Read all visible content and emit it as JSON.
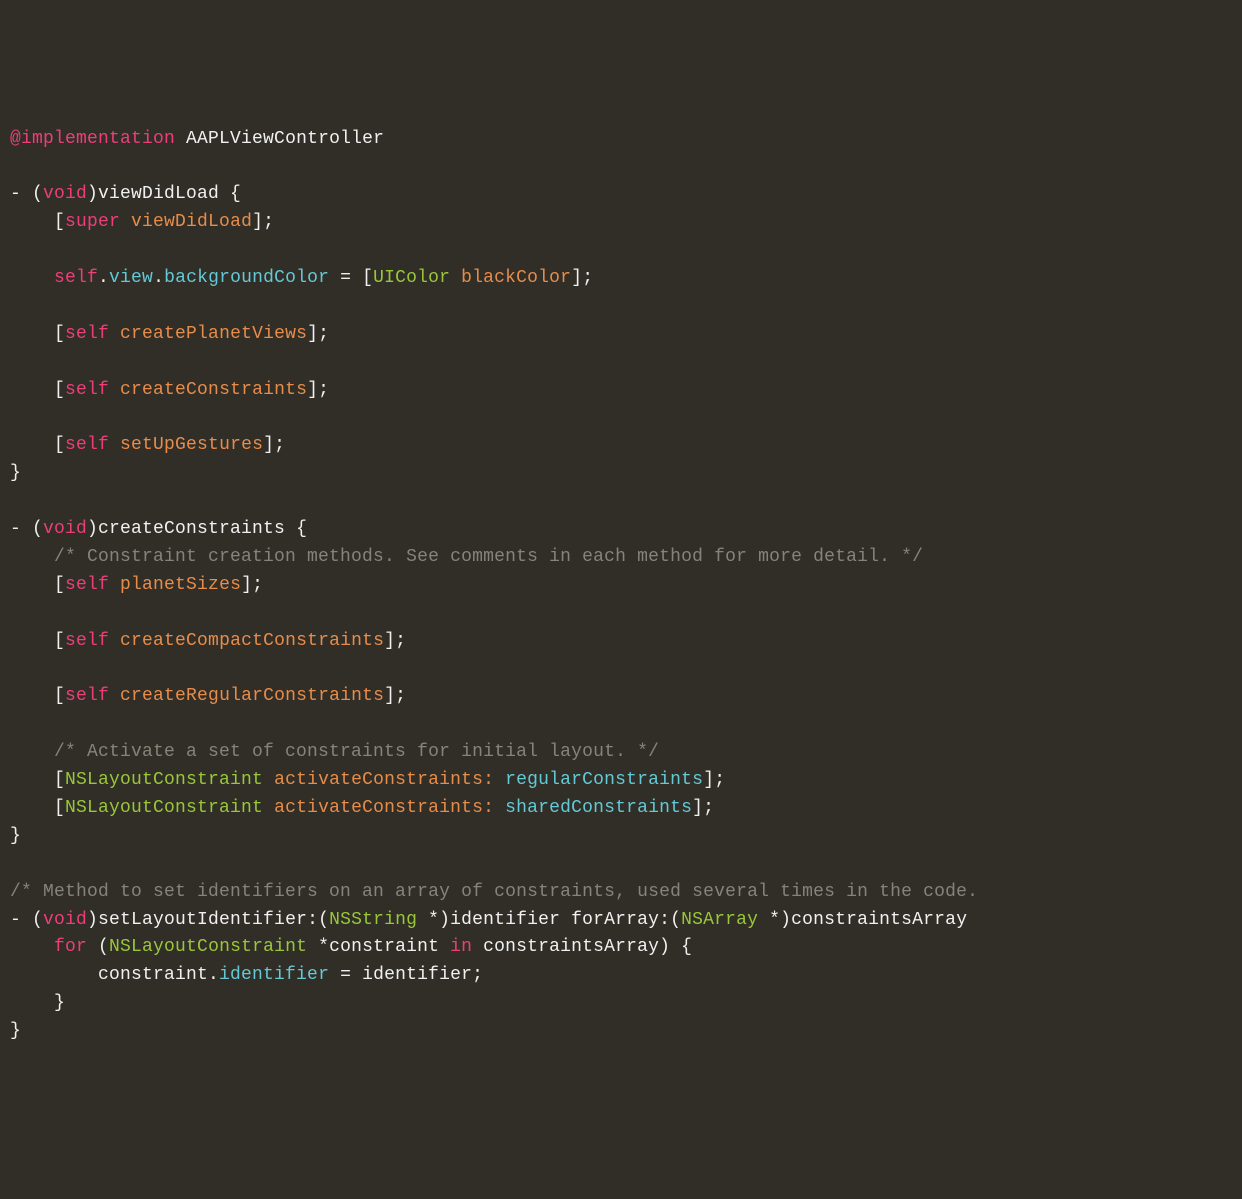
{
  "tokens": {
    "t1": "@implementation",
    "t2": "AAPLViewController",
    "t3": "- (",
    "t4": "void",
    "t5": ")viewDidLoad {",
    "t6": "    [",
    "t7": "super",
    "t8": "viewDidLoad",
    "t9": "];",
    "t10": "self",
    "t11": ".",
    "t12": "view",
    "t13": "backgroundColor",
    "t14": " = [",
    "t15": "UIColor",
    "t16": "blackColor",
    "t17": "createPlanetViews",
    "t18": "createConstraints",
    "t19": "setUpGestures",
    "t20": "}",
    "t21": ")createConstraints {",
    "t22": "    /* Constraint creation methods. See comments in each method for more detail. */",
    "t23": "planetSizes",
    "t24": "createCompactConstraints",
    "t25": "createRegularConstraints",
    "t26": "    /* Activate a set of constraints for initial layout. */",
    "t27": "NSLayoutConstraint",
    "t28": "activateConstraints:",
    "t29": "regularConstraints",
    "t30": "sharedConstraints",
    "t31": "/* Method to set identifiers on an array of constraints, used several times in the code.",
    "t32": ")setLayoutIdentifier:(",
    "t33": "NSString",
    "t34": " *)identifier forArray:(",
    "t35": "NSArray",
    "t36": " *)constraintsArray",
    "t37": "    ",
    "t38": "for",
    "t39": " (",
    "t40": " *constraint ",
    "t41": "in",
    "t42": " constraintsArray) {",
    "t43": "        constraint.",
    "t44": "identifier",
    "t45": " = identifier;",
    "t46": "    }",
    "sp4": "    ",
    "sp1": " "
  }
}
